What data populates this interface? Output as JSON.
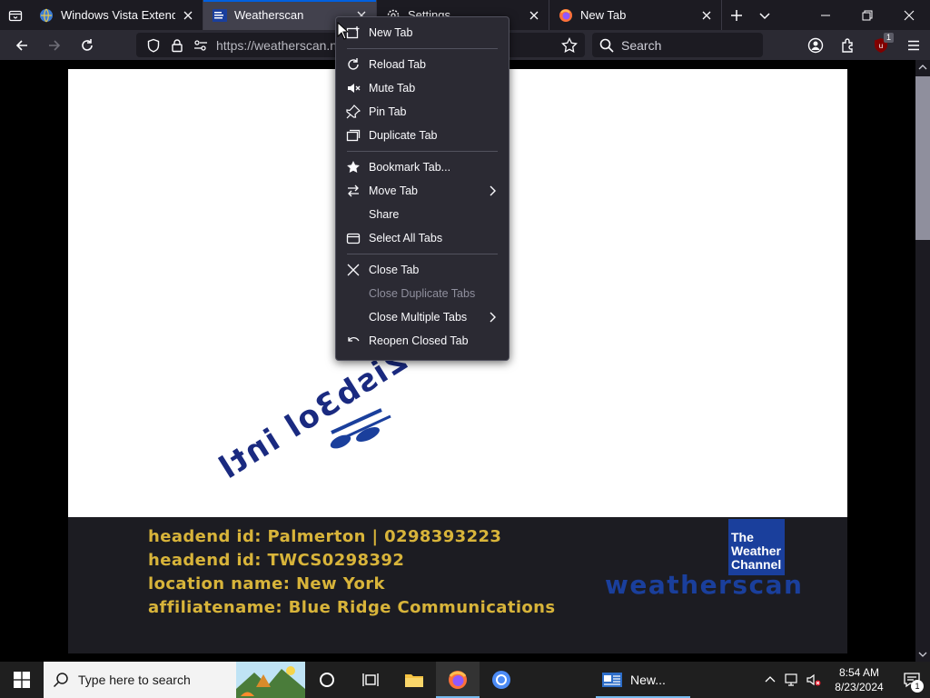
{
  "tabs": [
    {
      "title": "Windows Vista Extended",
      "icon": "globe-icon"
    },
    {
      "title": "Weatherscan",
      "icon": "weather-channel-icon",
      "active": true
    },
    {
      "title": "Settings",
      "icon": "gear-icon"
    },
    {
      "title": "New Tab",
      "icon": "firefox-icon"
    }
  ],
  "navbar": {
    "url": "https://weatherscan.n",
    "search_placeholder": "Search",
    "extension_badge": "1"
  },
  "context_menu": {
    "items": [
      {
        "label": "New Tab",
        "icon": "new-tab-icon"
      },
      {
        "label": "Reload Tab",
        "icon": "reload-icon"
      },
      {
        "label": "Mute Tab",
        "icon": "mute-icon"
      },
      {
        "label": "Pin Tab",
        "icon": "pin-icon"
      },
      {
        "label": "Duplicate Tab",
        "icon": "duplicate-icon"
      },
      {
        "label": "Bookmark Tab...",
        "icon": "star-icon"
      },
      {
        "label": "Move Tab",
        "icon": "move-icon",
        "submenu": true
      },
      {
        "label": "Share"
      },
      {
        "label": "Select All Tabs",
        "icon": "select-all-icon"
      },
      {
        "label": "Close Tab",
        "icon": "close-icon"
      },
      {
        "label": "Close Duplicate Tabs",
        "disabled": true
      },
      {
        "label": "Close Multiple Tabs",
        "submenu": true
      },
      {
        "label": "Reopen Closed Tab",
        "icon": "undo-icon"
      }
    ]
  },
  "page": {
    "stage_text": "2isb3ol intl",
    "info_lines": [
      "headend id: Palmerton | 0298393223",
      "headend id: TWCS0298392",
      "location name: New York",
      "affiliatename: Blue Ridge Communications"
    ],
    "logo_lines": [
      "The",
      "Weather",
      "Channel"
    ],
    "brand": "weatherscan",
    "brand_color": "#1a3f9c",
    "info_color": "#d8b43a"
  },
  "taskbar": {
    "search_placeholder": "Type here to search",
    "app_label": "New...",
    "time": "8:54 AM",
    "date": "8/23/2024",
    "notification_count": "1"
  },
  "colors": {
    "accent": "#0060df",
    "tabstrip": "#1c1b22",
    "toolbar": "#2b2a33"
  }
}
